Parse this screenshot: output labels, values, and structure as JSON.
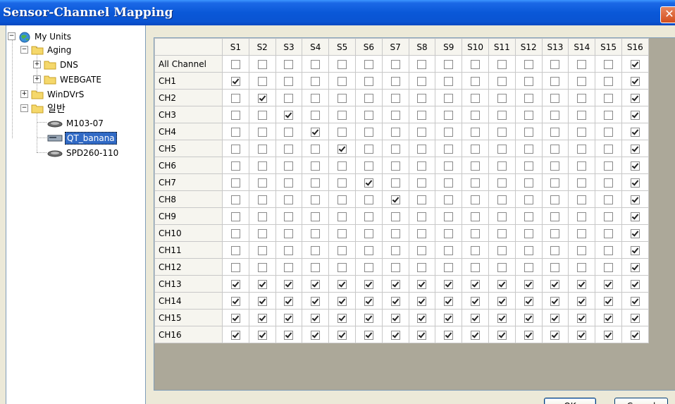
{
  "window": {
    "title": "Sensor-Channel Mapping",
    "close_glyph": "✕"
  },
  "tree": {
    "root": {
      "label": "My Units",
      "expander": "−"
    },
    "folders": [
      {
        "label": "Aging",
        "expander": "−"
      },
      {
        "label": "DNS",
        "expander": "+"
      },
      {
        "label": "WEBGATE",
        "expander": "+"
      },
      {
        "label": "WinDVrS",
        "expander": "+"
      },
      {
        "label": "일반",
        "expander": "−"
      }
    ],
    "devices": [
      {
        "label": "M103-07",
        "selected": false
      },
      {
        "label": "QT_banana",
        "selected": true
      },
      {
        "label": "SPD260-110",
        "selected": false
      }
    ]
  },
  "grid": {
    "columns": [
      "S1",
      "S2",
      "S3",
      "S4",
      "S5",
      "S6",
      "S7",
      "S8",
      "S9",
      "S10",
      "S11",
      "S12",
      "S13",
      "S14",
      "S15",
      "S16"
    ],
    "rows": [
      {
        "label": "All Channel",
        "checked": [
          16
        ]
      },
      {
        "label": "CH1",
        "checked": [
          1,
          16
        ]
      },
      {
        "label": "CH2",
        "checked": [
          2,
          16
        ]
      },
      {
        "label": "CH3",
        "checked": [
          3,
          16
        ]
      },
      {
        "label": "CH4",
        "checked": [
          4,
          16
        ]
      },
      {
        "label": "CH5",
        "checked": [
          5,
          16
        ]
      },
      {
        "label": "CH6",
        "checked": [
          16
        ]
      },
      {
        "label": "CH7",
        "checked": [
          6,
          16
        ]
      },
      {
        "label": "CH8",
        "checked": [
          7,
          16
        ]
      },
      {
        "label": "CH9",
        "checked": [
          16
        ]
      },
      {
        "label": "CH10",
        "checked": [
          16
        ]
      },
      {
        "label": "CH11",
        "checked": [
          16
        ]
      },
      {
        "label": "CH12",
        "checked": [
          16
        ]
      },
      {
        "label": "CH13",
        "checked": [
          1,
          2,
          3,
          4,
          5,
          6,
          7,
          8,
          9,
          10,
          11,
          12,
          13,
          14,
          15,
          16
        ]
      },
      {
        "label": "CH14",
        "checked": [
          1,
          2,
          3,
          4,
          5,
          6,
          7,
          8,
          9,
          10,
          11,
          12,
          13,
          14,
          15,
          16
        ]
      },
      {
        "label": "CH15",
        "checked": [
          1,
          2,
          3,
          4,
          5,
          6,
          7,
          8,
          9,
          10,
          11,
          12,
          13,
          14,
          15,
          16
        ]
      },
      {
        "label": "CH16",
        "checked": [
          1,
          2,
          3,
          4,
          5,
          6,
          7,
          8,
          9,
          10,
          11,
          12,
          13,
          14,
          15,
          16
        ]
      }
    ]
  },
  "buttons": {
    "ok_label": "OK",
    "cancel_label": "Cancel"
  },
  "colors": {
    "titlebar": "#0a58d8",
    "selection": "#316ac5",
    "dialog_bg": "#ece9d8"
  }
}
